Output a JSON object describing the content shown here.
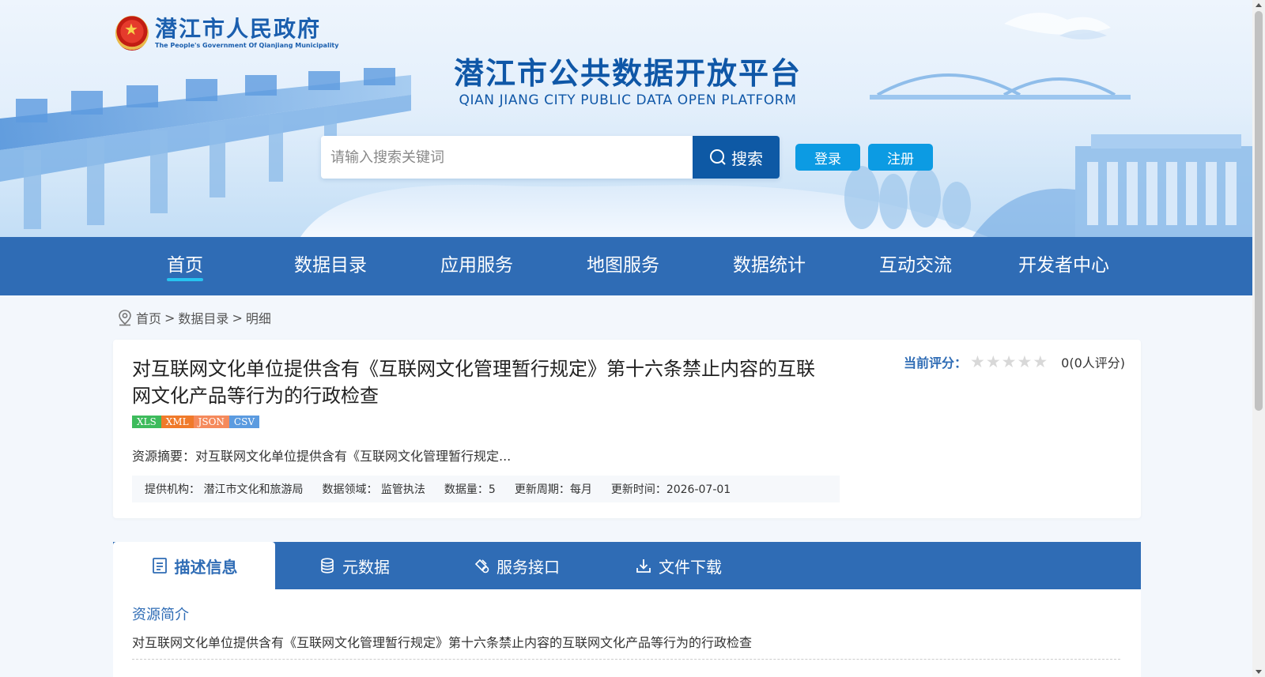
{
  "header": {
    "gov_name_cn": "潜江市人民政府",
    "gov_name_en": "The People's Government Of Qianjiang Municipality",
    "platform_title_cn": "潜江市公共数据开放平台",
    "platform_title_en": "QIAN JIANG CITY PUBLIC DATA OPEN PLATFORM",
    "search_placeholder": "请输入搜索关键词",
    "search_label": "搜索",
    "login_label": "登录",
    "register_label": "注册"
  },
  "nav": {
    "items": [
      "首页",
      "数据目录",
      "应用服务",
      "地图服务",
      "数据统计",
      "互动交流",
      "开发者中心"
    ],
    "active": "首页"
  },
  "breadcrumb": {
    "home": "首页",
    "sep1": ">",
    "catalog": "数据目录",
    "sep2": ">",
    "current": "明细"
  },
  "detail": {
    "title": "对互联网文化单位提供含有《互联网文化管理暂行规定》第十六条禁止内容的互联网文化产品等行为的行政检查",
    "formats": [
      {
        "label": "XLS",
        "color": "#3dbb5c"
      },
      {
        "label": "XML",
        "color": "#f07a2a"
      },
      {
        "label": "JSON",
        "color": "#f58a5c"
      },
      {
        "label": "CSV",
        "color": "#5b9be0"
      }
    ],
    "summary": "资源摘要：对互联网文化单位提供含有《互联网文化管理暂行规定...",
    "meta": {
      "provider": "提供机构： 潜江市文化和旅游局",
      "domain": "数据领域： 监管执法",
      "count": "数据量：5",
      "cycle": "更新周期：每月",
      "updated": "更新时间：2026-07-01"
    },
    "rating": {
      "label": "当前评分：",
      "stars": 0,
      "max_stars": 5,
      "score_text": "0(0人评分)"
    }
  },
  "tabs": {
    "items": [
      "描述信息",
      "元数据",
      "服务接口",
      "文件下载"
    ],
    "active": "描述信息"
  },
  "content": {
    "section1_title": "资源简介",
    "section1_text": "对互联网文化单位提供含有《互联网文化管理暂行规定》第十六条禁止内容的互联网文化产品等行为的行政检查"
  },
  "colors": {
    "nav_bg": "#2f6cb5",
    "search_btn": "#0e59a5",
    "auth_btn": "#0c9be3",
    "nav_underline": "#26c4f0"
  }
}
